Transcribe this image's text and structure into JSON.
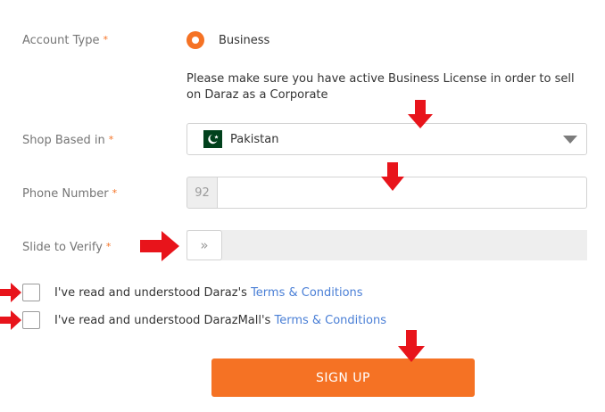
{
  "account_type": {
    "label": "Account Type",
    "required_mark": "*",
    "selected_option": "Business",
    "notice": "Please make sure you have active Business License in order to sell on Daraz as a Corporate"
  },
  "shop_based_in": {
    "label": "Shop Based in",
    "required_mark": "*",
    "value": "Pakistan",
    "flag_icon": "pakistan-flag-icon"
  },
  "phone_number": {
    "label": "Phone Number",
    "required_mark": "*",
    "prefix": "92",
    "value": ""
  },
  "slide_to_verify": {
    "label": "Slide to Verify",
    "required_mark": "*",
    "handle_icon": "»"
  },
  "terms": [
    {
      "text": "I've read and understood Daraz's ",
      "link": "Terms & Conditions",
      "checked": false
    },
    {
      "text": "I've read and understood DarazMall's ",
      "link": "Terms & Conditions",
      "checked": false
    }
  ],
  "signup_button": {
    "label": "SIGN UP"
  },
  "colors": {
    "accent": "#f57224",
    "link": "#4a7fd6",
    "annotation_arrow": "#e8141b"
  }
}
